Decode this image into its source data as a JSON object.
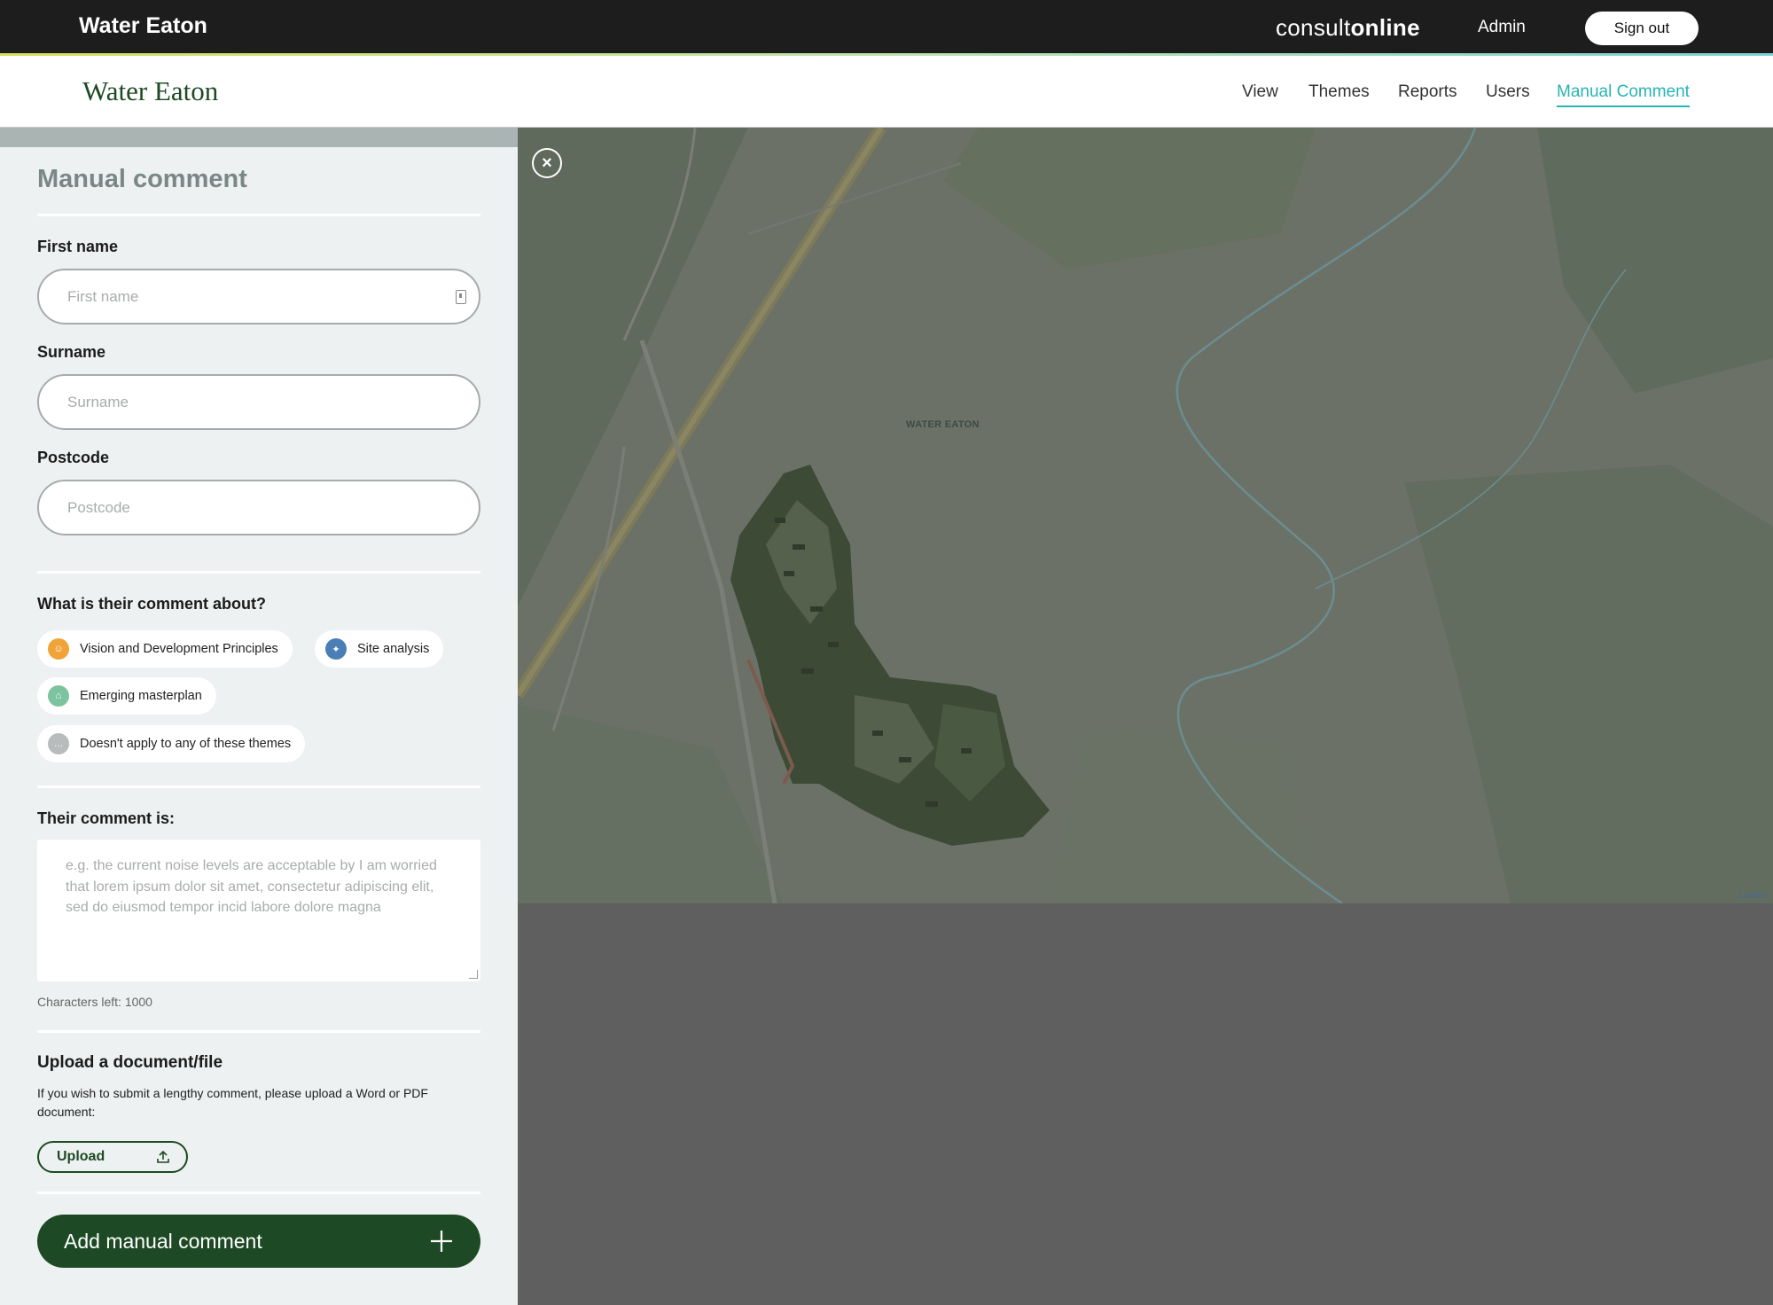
{
  "topbar": {
    "app_title": "Water Eaton",
    "brand_light": "consult",
    "brand_bold": "online",
    "admin_label": "Admin",
    "signout_label": "Sign out"
  },
  "navbar": {
    "logo": "Water Eaton",
    "items": [
      {
        "label": "View"
      },
      {
        "label": "Themes"
      },
      {
        "label": "Reports"
      },
      {
        "label": "Users"
      },
      {
        "label": "Manual Comment",
        "active": true
      }
    ],
    "active_color": "#2ab3b3"
  },
  "form": {
    "title": "Manual comment",
    "first_name": {
      "label": "First name",
      "placeholder": "First name",
      "value": ""
    },
    "surname": {
      "label": "Surname",
      "placeholder": "Surname",
      "value": ""
    },
    "postcode": {
      "label": "Postcode",
      "placeholder": "Postcode",
      "value": ""
    },
    "themes_question": "What is their comment about?",
    "themes": [
      {
        "label": "Vision and Development Principles",
        "color": "#f0a437",
        "icon": "people-icon"
      },
      {
        "label": "Site analysis",
        "color": "#4a7fb5",
        "icon": "lightbulb-icon"
      },
      {
        "label": "Emerging masterplan",
        "color": "#7cc4a0",
        "icon": "masterplan-icon"
      },
      {
        "label": "Doesn't apply to any of these themes",
        "color": "#b9bcbc",
        "icon": "chat-icon"
      }
    ],
    "comment_label": "Their comment is:",
    "comment_placeholder": "e.g. the current noise levels are acceptable by I am worried that lorem ipsum dolor sit amet, consectetur adipiscing elit, sed do eiusmod tempor incid labore dolore magna",
    "chars_left": "Characters left: 1000",
    "upload_title": "Upload a document/file",
    "upload_desc": "If you wish to submit a lengthy comment, please upload a Word or PDF document:",
    "upload_label": "Upload",
    "submit_label": "Add manual comment",
    "brand_green": "#1d4a24"
  },
  "map": {
    "place_label": "WATER EATON",
    "attribution": "Leaflet"
  }
}
